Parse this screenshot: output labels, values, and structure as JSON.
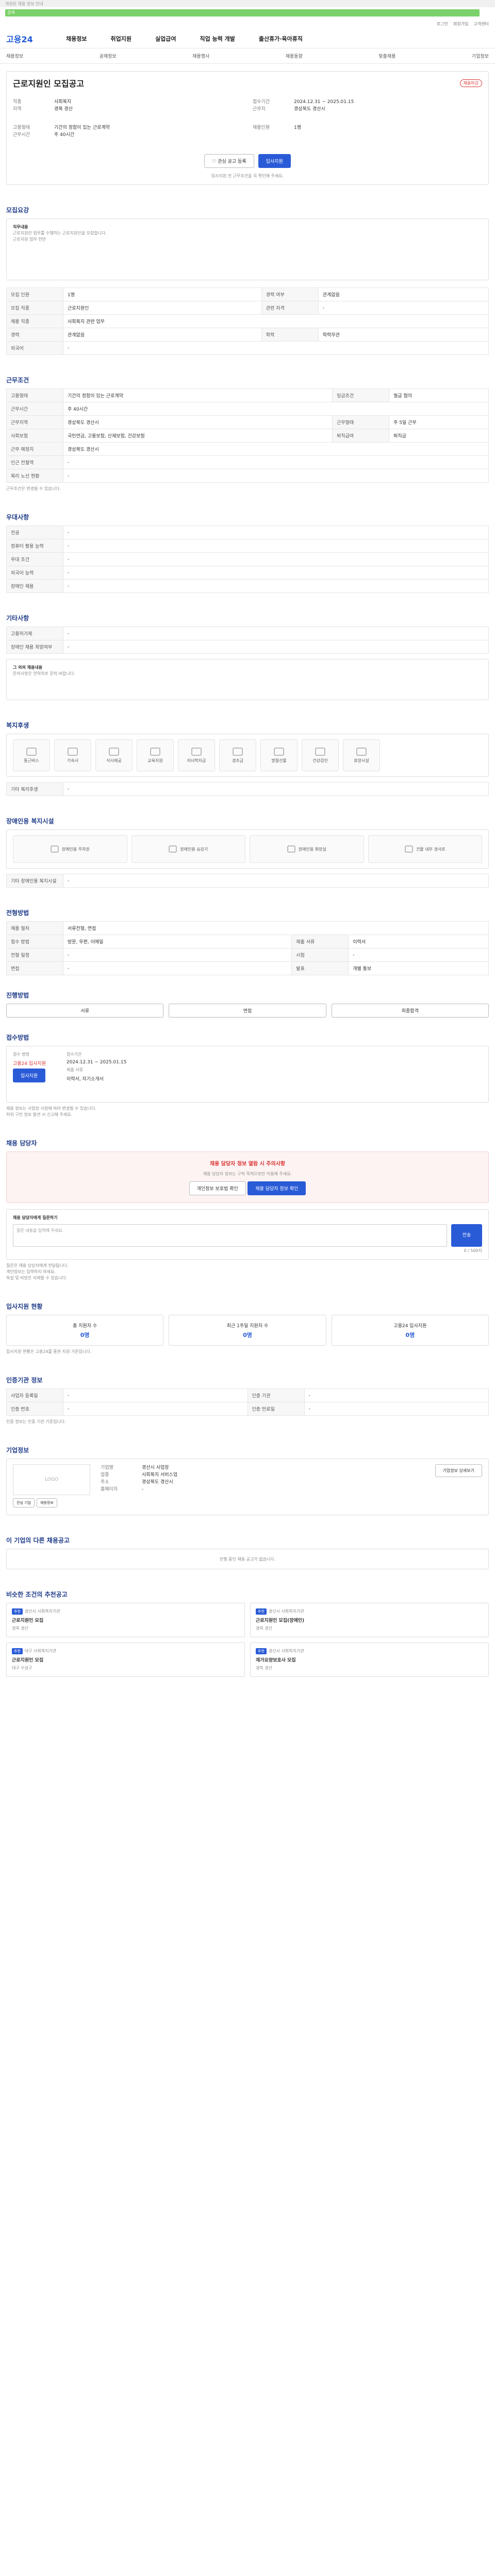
{
  "banner": "개정된 채용 정보 안내",
  "search": {
    "placeholder": "검색"
  },
  "util": [
    "로그인",
    "회원가입",
    "고객센터"
  ],
  "gnb": {
    "logo": "고용24",
    "menus": [
      "채용정보",
      "취업지원",
      "실업급여",
      "직업 능력 개발",
      "출산휴가·육아휴직"
    ]
  },
  "subnav": [
    "채용정보",
    "공채정보",
    "채용행사",
    "채용동향",
    "맞춤채용",
    "기업정보"
  ],
  "job": {
    "title": "근로지원인 모집공고",
    "badge": "채용마감",
    "left": [
      {
        "k": "직종",
        "v": "사회복지"
      },
      {
        "k": "지역",
        "v": "경북 경산"
      }
    ],
    "right": [
      {
        "k": "접수기간",
        "v": "2024.12.31 ~ 2025.01.15"
      },
      {
        "k": "근무지",
        "v": "경상북도 경산시"
      }
    ],
    "left2": [
      {
        "k": "고용형태",
        "v": "기간의 정함이 있는 근로계약"
      },
      {
        "k": "근무시간",
        "v": "주 40시간"
      }
    ],
    "right2": [
      {
        "k": "채용인원",
        "v": "1명"
      }
    ],
    "fav_label": "관심 공고 등록",
    "apply_label": "입사지원",
    "note": "입사지원 전 근무조건을 꼭 확인해 주세요."
  },
  "summary": {
    "title": "모집요강",
    "body": [
      "직무내용",
      "근로지원인 업무를 수행하는 근로지원인을 모집합니다.",
      "",
      "근로지원 업무 전반"
    ]
  },
  "detail_rows": [
    [
      "모집 인원",
      "1명",
      "경력 여부",
      "관계없음"
    ],
    [
      "모집 직종",
      "근로지원인",
      "관련 자격",
      "-"
    ],
    [
      "채용 직종",
      "사회복지 관련 업무",
      "",
      ""
    ],
    [
      "경력",
      "관계없음",
      "학력",
      "학력무관"
    ],
    [
      "외국어",
      "-",
      "",
      ""
    ]
  ],
  "cond": {
    "title": "근무조건",
    "rows": [
      [
        "고용형태",
        "기간의 정함이 있는 근로계약",
        "임금조건",
        "월급 협의"
      ],
      [
        "근무시간",
        "주 40시간",
        "",
        ""
      ],
      [
        "근무지역",
        "경상북도 경산시",
        "근무형태",
        "주 5일 근무"
      ],
      [
        "사회보험",
        "국민연금, 고용보험, 산재보험, 건강보험",
        "퇴직급여",
        "퇴직금"
      ],
      [
        "근무 예정지",
        "경상북도 경산시",
        "",
        ""
      ],
      [
        "인근 전철역",
        "-",
        "",
        ""
      ],
      [
        "복리 노선 현황",
        "-",
        "",
        ""
      ]
    ],
    "note": "근무조건은 변경될 수 있습니다."
  },
  "pref": {
    "title": "우대사항",
    "rows": [
      [
        "전공",
        "-"
      ],
      [
        "컴퓨터 활용 능력",
        "-"
      ],
      [
        "우대 조건",
        "-"
      ],
      [
        "외국어 능력",
        "-"
      ],
      [
        "장애인 채용",
        "-"
      ]
    ]
  },
  "etc": {
    "title": "기타사항",
    "rows": [
      [
        "고용허가제",
        "-"
      ],
      [
        "장애인 채용 희망여부",
        "-"
      ]
    ],
    "extra": [
      "그 외의 채용내용",
      "문의사항은 연락처로 문의 바랍니다."
    ]
  },
  "welfare": {
    "title": "복지후생",
    "tiles": [
      "통근버스",
      "기숙사",
      "식사제공",
      "교육지원",
      "자녀학자금",
      "경조금",
      "명절선물",
      "건강검진",
      "휴양시설"
    ],
    "misc_label": "기타 복리후생",
    "misc_value": "-"
  },
  "disab": {
    "title": "장애인용 복지시설",
    "tiles": [
      "장애인용 주차장",
      "장애인용 승강기",
      "장애인용 화장실",
      "건물 내부 경사로"
    ],
    "misc_label": "기타 장애인용 복지시설",
    "misc_value": "-"
  },
  "process": {
    "title": "전형방법",
    "rows": [
      [
        "채용 절차",
        "서류전형, 면접",
        "",
        ""
      ],
      [
        "접수 방법",
        "방문, 우편, 이메일",
        "제출 서류",
        "이력서"
      ],
      [
        "전형 일정",
        "-",
        "시험",
        "-"
      ],
      [
        "면접",
        "-",
        "발표",
        "개별 통보"
      ]
    ]
  },
  "steps": {
    "title": "진행방법",
    "items": [
      "서류",
      "면접",
      "최종합격"
    ]
  },
  "apply": {
    "title": "접수방법",
    "method_label": "접수 방법",
    "method_value": "고용24 입사지원",
    "period_label": "접수기간",
    "period_value": "2024.12.31 ~ 2025.01.15",
    "doc_label": "제출 서류",
    "doc_value": "이력서, 자기소개서",
    "btn": "입사지원",
    "notes": [
      "채용 정보는 사업장 사정에 따라 변경될 수 있습니다.",
      "허위 구인 정보 발견 시 신고해 주세요."
    ]
  },
  "manager": {
    "title": "채용 담당자",
    "alert": "채용 담당자 정보 열람 시 주의사항",
    "alert_body": "채용 담당자 정보는 구직 목적으로만 이용해 주세요.",
    "btn1": "개인정보 보호법 확인",
    "btn2": "채용 담당자 정보 확인",
    "q_label": "채용 담당자에게 질문하기",
    "q_placeholder": "질문 내용을 입력해 주세요.",
    "q_count": "0 / 500자",
    "q_btn": "전송",
    "notes": [
      "질문은 채용 담당자에게 전달됩니다.",
      "개인정보는 입력하지 마세요.",
      "욕설 및 비방은 삭제될 수 있습니다."
    ]
  },
  "status": {
    "title": "입사지원 현황",
    "items": [
      {
        "label": "총 지원자 수",
        "value": "0명"
      },
      {
        "label": "최근 1주일 지원자 수",
        "value": "0명"
      },
      {
        "label": "고용24 입사지원",
        "value": "0명"
      }
    ],
    "note": "입사지원 현황은 고용24를 통한 지원 기준입니다."
  },
  "auth": {
    "title": "인증기관 정보",
    "rows": [
      [
        "사업자 등록일",
        "-",
        "인증 기관",
        "-"
      ],
      [
        "인증 번호",
        "-",
        "인증 만료일",
        "-"
      ]
    ],
    "note": "인증 정보는 인증 기관 기준입니다."
  },
  "company": {
    "title": "기업정보",
    "logo": "LOGO",
    "rows": [
      [
        "기업명",
        "경산시 사업장"
      ],
      [
        "업종",
        "사회복지 서비스업"
      ],
      [
        "주소",
        "경상북도 경산시"
      ],
      [
        "홈페이지",
        "-"
      ]
    ],
    "btn1": "관심 기업",
    "btn2": "채용정보",
    "more": "기업정보 상세보기"
  },
  "other": {
    "title": "이 기업의 다른 채용공고",
    "empty": "진행 중인 채용 공고가 없습니다."
  },
  "similar": {
    "title": "비슷한 조건의 추천공고",
    "cards": [
      {
        "tag": "추천",
        "company": "경산시 사회복지기관",
        "title": "근로지원인 모집",
        "meta": "경북 경산"
      },
      {
        "tag": "추천",
        "company": "경산시 사회복지기관",
        "title": "근로지원인 모집(장애인)",
        "meta": "경북 경산"
      },
      {
        "tag": "추천",
        "company": "대구 사회복지기관",
        "title": "근로지원인 모집",
        "meta": "대구 수성구"
      },
      {
        "tag": "추천",
        "company": "경산시 사회복지기관",
        "title": "재가요양보호사 모집",
        "meta": "경북 경산"
      }
    ]
  }
}
